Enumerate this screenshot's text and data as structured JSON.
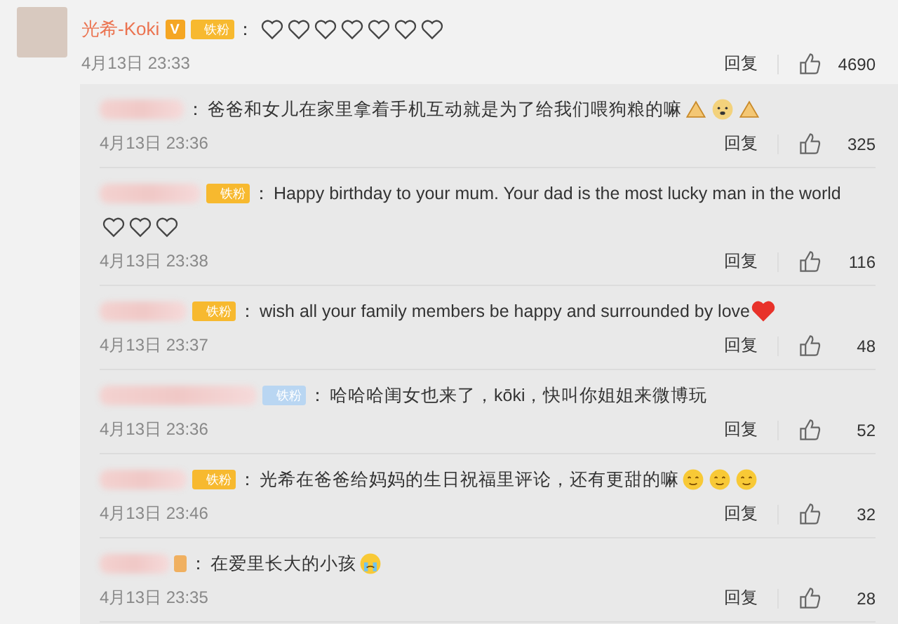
{
  "comment": {
    "author": "光希-Koki",
    "verified_badge": "V",
    "fan_badge": "铁粉",
    "separator": "：",
    "time": "4月13日 23:33",
    "reply_label": "回复",
    "likes": "4690"
  },
  "replies": [
    {
      "separator": "：",
      "text": "爸爸和女儿在家里拿着手机互动就是为了给我们喂狗粮的嘛",
      "time": "4月13日 23:36",
      "reply_label": "回复",
      "likes": "325"
    },
    {
      "badge": {
        "text": "铁粉",
        "color": "#f7b92f"
      },
      "separator": "：",
      "text": "Happy birthday to your mum.  Your dad is the most lucky man in the world",
      "time": "4月13日 23:38",
      "reply_label": "回复",
      "likes": "116"
    },
    {
      "badge": {
        "text": "铁粉",
        "color": "#f7b92f"
      },
      "separator": "：",
      "text": "wish all your family members be happy and surrounded by love",
      "time": "4月13日 23:37",
      "reply_label": "回复",
      "likes": "48"
    },
    {
      "badge": {
        "text": "铁粉",
        "color": "#b9d6f2"
      },
      "separator": "：",
      "text": "哈哈哈闺女也来了，kōki，快叫你姐姐来微博玩",
      "time": "4月13日 23:36",
      "reply_label": "回复",
      "likes": "52"
    },
    {
      "badge": {
        "text": "铁粉",
        "color": "#f7b92f"
      },
      "separator": "：",
      "text": "光希在爸爸给妈妈的生日祝福里评论，还有更甜的嘛",
      "time": "4月13日 23:46",
      "reply_label": "回复",
      "likes": "32"
    },
    {
      "badge": {
        "color": "#f0b060"
      },
      "separator": "：",
      "text": "在爱里长大的小孩",
      "time": "4月13日 23:35",
      "reply_label": "回复",
      "likes": "28"
    }
  ]
}
